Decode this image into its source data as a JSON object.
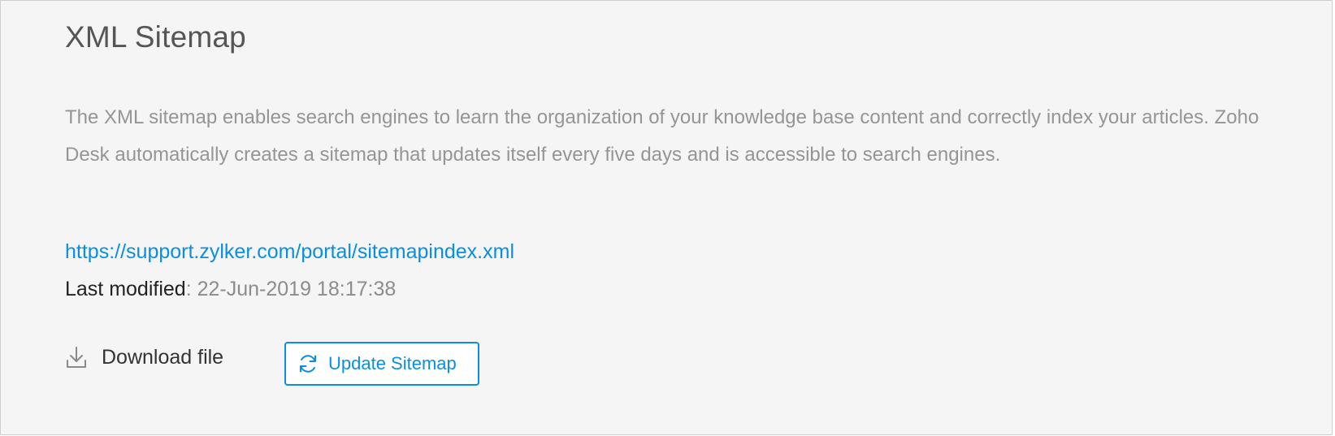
{
  "section": {
    "title": "XML Sitemap",
    "description": "The XML sitemap enables search engines to learn the organization of your knowledge base content and correctly index your articles. Zoho Desk automatically creates a sitemap that updates itself every five days and is accessible to search engines.",
    "sitemap_url": "https://support.zylker.com/portal/sitemapindex.xml",
    "last_modified": {
      "label": "Last modified",
      "separator": ": ",
      "value": "22-Jun-2019 18:17:38"
    },
    "actions": {
      "download_label": "Download file",
      "download_icon": "download-icon",
      "update_label": "Update Sitemap",
      "update_icon": "refresh-icon"
    }
  },
  "colors": {
    "accent": "#0a8ee0",
    "panel_background": "#f5f5f5",
    "muted_text": "#959595"
  }
}
